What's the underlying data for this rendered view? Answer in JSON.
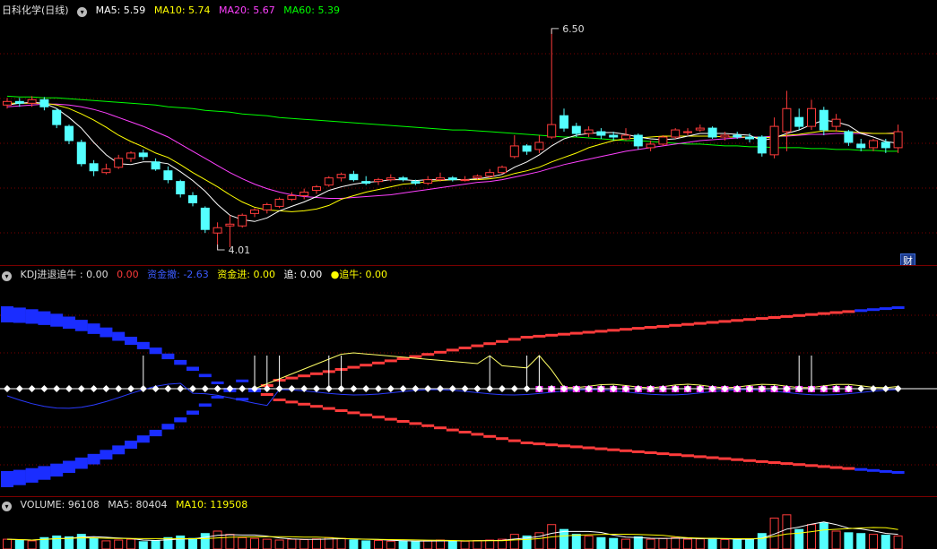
{
  "main": {
    "title": "日科化学(日线)",
    "ma5": "MA5: 5.59",
    "ma10": "MA10: 5.74",
    "ma20": "MA20: 5.67",
    "ma60": "MA60: 5.39",
    "high_label": "6.50",
    "low_label": "4.01",
    "cai_button": "财"
  },
  "kdj": {
    "title": "KDJ进退追牛 : 0.00",
    "v1": "0.00",
    "fund_out": "资金撤: -2.63",
    "fund_in": "资金进: 0.00",
    "chase": "追: 0.00",
    "chase_bull": "●追牛: 0.00"
  },
  "volume": {
    "title": "VOLUME: 96108",
    "ma5": "MA5: 80404",
    "ma10": "MA10: 119508"
  },
  "colors": {
    "up": "#ff3b3b",
    "down": "#54ffff",
    "ma5": "#ffffff",
    "ma10": "#ffff00",
    "ma20": "#ff40ff",
    "ma60": "#00ff00",
    "grid": "#7a0000"
  },
  "candles": [
    [
      5.64,
      5.68,
      5.72,
      5.6
    ],
    [
      5.68,
      5.66,
      5.72,
      5.62
    ],
    [
      5.66,
      5.7,
      5.74,
      5.62
    ],
    [
      5.7,
      5.62,
      5.73,
      5.58
    ],
    [
      5.58,
      5.42,
      5.6,
      5.38
    ],
    [
      5.4,
      5.24,
      5.42,
      5.2
    ],
    [
      5.22,
      4.98,
      5.25,
      4.95
    ],
    [
      4.98,
      4.9,
      5.02,
      4.84
    ],
    [
      4.88,
      4.92,
      4.98,
      4.86
    ],
    [
      4.94,
      5.04,
      5.08,
      4.92
    ],
    [
      5.04,
      5.1,
      5.12,
      5.0
    ],
    [
      5.1,
      5.06,
      5.14,
      5.02
    ],
    [
      5.0,
      4.92,
      5.04,
      4.9
    ],
    [
      4.9,
      4.8,
      4.95,
      4.76
    ],
    [
      4.78,
      4.64,
      4.8,
      4.6
    ],
    [
      4.62,
      4.54,
      4.66,
      4.5
    ],
    [
      4.48,
      4.24,
      4.5,
      4.2
    ],
    [
      4.2,
      4.26,
      4.32,
      4.01
    ],
    [
      4.28,
      4.3,
      4.4,
      4.04
    ],
    [
      4.28,
      4.4,
      4.42,
      4.26
    ],
    [
      4.42,
      4.46,
      4.48,
      4.38
    ],
    [
      4.46,
      4.52,
      4.54,
      4.42
    ],
    [
      4.5,
      4.58,
      4.6,
      4.48
    ],
    [
      4.58,
      4.62,
      4.66,
      4.56
    ],
    [
      4.62,
      4.66,
      4.7,
      4.58
    ],
    [
      4.68,
      4.72,
      4.74,
      4.64
    ],
    [
      4.74,
      4.82,
      4.84,
      4.72
    ],
    [
      4.82,
      4.86,
      4.88,
      4.78
    ],
    [
      4.86,
      4.8,
      4.9,
      4.78
    ],
    [
      4.78,
      4.76,
      4.84,
      4.74
    ],
    [
      4.78,
      4.8,
      4.82,
      4.74
    ],
    [
      4.8,
      4.82,
      4.86,
      4.78
    ],
    [
      4.82,
      4.8,
      4.84,
      4.78
    ],
    [
      4.78,
      4.76,
      4.8,
      4.74
    ],
    [
      4.76,
      4.8,
      4.84,
      4.74
    ],
    [
      4.8,
      4.82,
      4.88,
      4.78
    ],
    [
      4.82,
      4.8,
      4.84,
      4.78
    ],
    [
      4.8,
      4.8,
      4.84,
      4.78
    ],
    [
      4.82,
      4.84,
      4.86,
      4.8
    ],
    [
      4.84,
      4.88,
      4.92,
      4.82
    ],
    [
      4.88,
      4.94,
      4.96,
      4.86
    ],
    [
      5.06,
      5.18,
      5.3,
      5.04
    ],
    [
      5.18,
      5.12,
      5.2,
      5.08
    ],
    [
      5.14,
      5.22,
      5.3,
      5.1
    ],
    [
      5.28,
      5.42,
      6.5,
      5.26
    ],
    [
      5.52,
      5.38,
      5.6,
      5.34
    ],
    [
      5.4,
      5.32,
      5.44,
      5.28
    ],
    [
      5.32,
      5.36,
      5.4,
      5.28
    ],
    [
      5.34,
      5.3,
      5.38,
      5.26
    ],
    [
      5.3,
      5.28,
      5.34,
      5.24
    ],
    [
      5.26,
      5.3,
      5.38,
      5.24
    ],
    [
      5.3,
      5.18,
      5.32,
      5.14
    ],
    [
      5.16,
      5.2,
      5.24,
      5.12
    ],
    [
      5.2,
      5.28,
      5.3,
      5.18
    ],
    [
      5.28,
      5.36,
      5.38,
      5.26
    ],
    [
      5.34,
      5.34,
      5.38,
      5.3
    ],
    [
      5.36,
      5.38,
      5.42,
      5.34
    ],
    [
      5.38,
      5.28,
      5.4,
      5.26
    ],
    [
      5.28,
      5.3,
      5.34,
      5.24
    ],
    [
      5.3,
      5.28,
      5.34,
      5.26
    ],
    [
      5.28,
      5.26,
      5.32,
      5.22
    ],
    [
      5.28,
      5.1,
      5.3,
      5.06
    ],
    [
      5.08,
      5.4,
      5.5,
      5.04
    ],
    [
      5.34,
      5.6,
      5.8,
      5.12
    ],
    [
      5.5,
      5.4,
      5.6,
      5.36
    ],
    [
      5.4,
      5.6,
      5.7,
      5.36
    ],
    [
      5.58,
      5.36,
      5.62,
      5.3
    ],
    [
      5.4,
      5.48,
      5.54,
      5.34
    ],
    [
      5.34,
      5.22,
      5.36,
      5.18
    ],
    [
      5.2,
      5.16,
      5.26,
      5.12
    ],
    [
      5.16,
      5.24,
      5.26,
      5.12
    ],
    [
      5.22,
      5.16,
      5.26,
      5.1
    ],
    [
      5.16,
      5.34,
      5.42,
      5.1
    ]
  ],
  "ma_series": {
    "ma5": [
      5.64,
      5.66,
      5.67,
      5.66,
      5.6,
      5.5,
      5.38,
      5.22,
      5.08,
      4.98,
      4.97,
      5.0,
      5.0,
      4.98,
      4.89,
      4.79,
      4.67,
      4.52,
      4.4,
      4.35,
      4.33,
      4.37,
      4.45,
      4.5,
      4.55,
      4.61,
      4.68,
      4.72,
      4.75,
      4.77,
      4.78,
      4.8,
      4.8,
      4.79,
      4.8,
      4.8,
      4.8,
      4.8,
      4.81,
      4.83,
      4.86,
      4.94,
      5.0,
      5.08,
      5.18,
      5.26,
      5.3,
      5.32,
      5.33,
      5.33,
      5.31,
      5.28,
      5.26,
      5.25,
      5.26,
      5.29,
      5.32,
      5.32,
      5.32,
      5.31,
      5.3,
      5.24,
      5.27,
      5.32,
      5.36,
      5.42,
      5.47,
      5.45,
      5.41,
      5.32,
      5.28,
      5.23,
      5.21
    ],
    "ma10": [
      5.66,
      5.66,
      5.66,
      5.66,
      5.64,
      5.6,
      5.54,
      5.47,
      5.39,
      5.3,
      5.23,
      5.17,
      5.1,
      5.05,
      4.97,
      4.88,
      4.8,
      4.72,
      4.63,
      4.55,
      4.49,
      4.46,
      4.45,
      4.44,
      4.45,
      4.47,
      4.51,
      4.58,
      4.62,
      4.66,
      4.69,
      4.72,
      4.75,
      4.76,
      4.78,
      4.79,
      4.8,
      4.8,
      4.8,
      4.81,
      4.83,
      4.87,
      4.9,
      4.94,
      5.0,
      5.05,
      5.1,
      5.16,
      5.2,
      5.24,
      5.26,
      5.27,
      5.28,
      5.29,
      5.29,
      5.29,
      5.29,
      5.29,
      5.28,
      5.28,
      5.28,
      5.27,
      5.28,
      5.3,
      5.31,
      5.33,
      5.35,
      5.35,
      5.34,
      5.33,
      5.32,
      5.32,
      5.32
    ],
    "ma20": [
      5.62,
      5.63,
      5.64,
      5.65,
      5.65,
      5.64,
      5.62,
      5.59,
      5.55,
      5.5,
      5.45,
      5.4,
      5.34,
      5.28,
      5.2,
      5.12,
      5.04,
      4.96,
      4.88,
      4.81,
      4.75,
      4.7,
      4.66,
      4.63,
      4.61,
      4.6,
      4.59,
      4.59,
      4.6,
      4.61,
      4.62,
      4.63,
      4.65,
      4.67,
      4.69,
      4.71,
      4.73,
      4.75,
      4.77,
      4.78,
      4.8,
      4.83,
      4.86,
      4.89,
      4.93,
      4.97,
      5.0,
      5.03,
      5.06,
      5.09,
      5.12,
      5.14,
      5.16,
      5.18,
      5.2,
      5.22,
      5.24,
      5.25,
      5.26,
      5.27,
      5.28,
      5.28,
      5.29,
      5.29,
      5.3,
      5.31,
      5.31,
      5.32,
      5.32,
      5.32,
      5.32,
      5.32,
      5.33
    ],
    "ma60": [
      5.74,
      5.73,
      5.73,
      5.72,
      5.72,
      5.71,
      5.7,
      5.69,
      5.68,
      5.67,
      5.66,
      5.65,
      5.64,
      5.62,
      5.61,
      5.6,
      5.58,
      5.57,
      5.56,
      5.54,
      5.53,
      5.52,
      5.5,
      5.49,
      5.48,
      5.47,
      5.46,
      5.45,
      5.44,
      5.43,
      5.42,
      5.41,
      5.4,
      5.39,
      5.38,
      5.37,
      5.36,
      5.36,
      5.35,
      5.34,
      5.33,
      5.32,
      5.31,
      5.3,
      5.29,
      5.28,
      5.28,
      5.27,
      5.26,
      5.25,
      5.24,
      5.24,
      5.23,
      5.22,
      5.21,
      5.2,
      5.2,
      5.19,
      5.18,
      5.18,
      5.17,
      5.17,
      5.16,
      5.16,
      5.16,
      5.15,
      5.15,
      5.14,
      5.14,
      5.13,
      5.13,
      5.12,
      5.12
    ]
  },
  "volumes": [
    60,
    55,
    50,
    70,
    80,
    75,
    90,
    65,
    50,
    55,
    60,
    45,
    50,
    70,
    80,
    65,
    95,
    110,
    90,
    70,
    65,
    60,
    55,
    60,
    58,
    62,
    70,
    65,
    55,
    50,
    52,
    48,
    50,
    45,
    50,
    55,
    50,
    48,
    52,
    55,
    60,
    90,
    80,
    100,
    150,
    120,
    90,
    80,
    70,
    65,
    60,
    75,
    60,
    65,
    70,
    60,
    62,
    66,
    58,
    55,
    60,
    95,
    190,
    210,
    120,
    150,
    160,
    110,
    100,
    95,
    90,
    85,
    80
  ]
}
